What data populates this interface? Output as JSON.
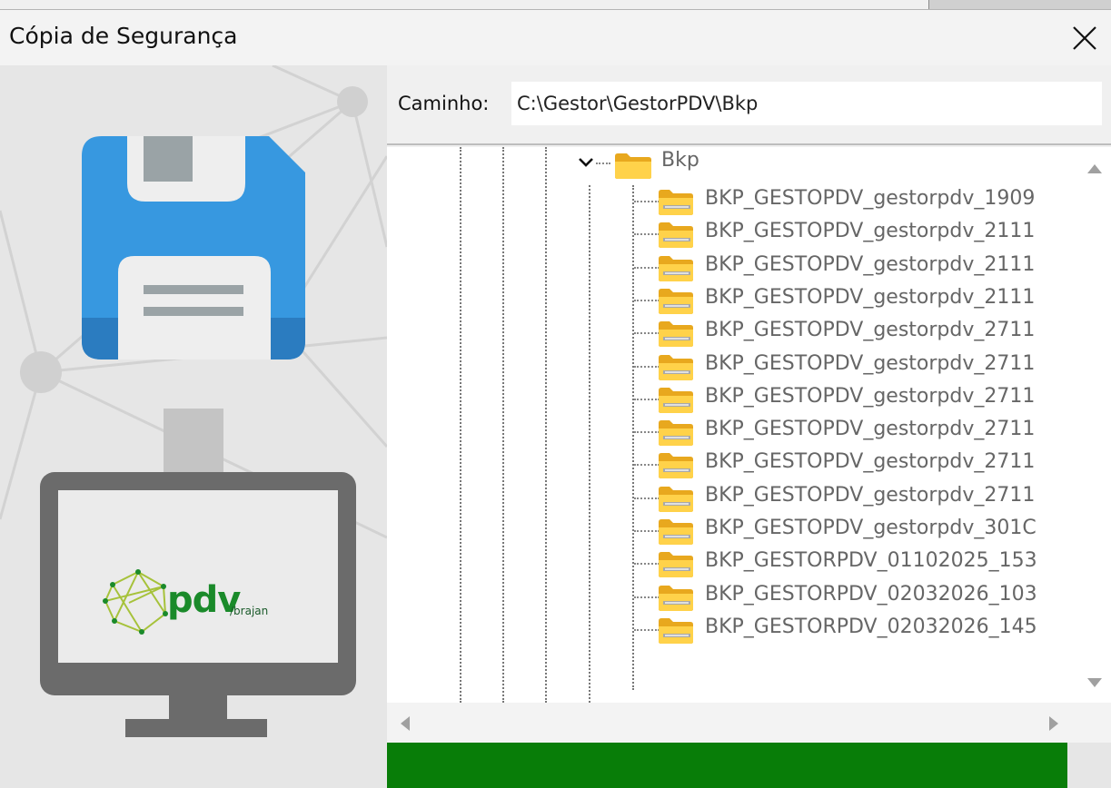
{
  "window": {
    "title": "Cópia de Segurança"
  },
  "branding": {
    "logo_text": "pdv",
    "logo_sub": "/brajan"
  },
  "path": {
    "label": "Caminho:",
    "value": "C:\\Gestor\\GestorPDV\\Bkp"
  },
  "tree": {
    "root": "Bkp",
    "items": [
      "BKP_GESTOPDV_gestorpdv_1909",
      "BKP_GESTOPDV_gestorpdv_2111",
      "BKP_GESTOPDV_gestorpdv_2111",
      "BKP_GESTOPDV_gestorpdv_2111",
      "BKP_GESTOPDV_gestorpdv_2711",
      "BKP_GESTOPDV_gestorpdv_2711",
      "BKP_GESTOPDV_gestorpdv_2711",
      "BKP_GESTOPDV_gestorpdv_2711",
      "BKP_GESTOPDV_gestorpdv_2711",
      "BKP_GESTOPDV_gestorpdv_2711",
      "BKP_GESTOPDV_gestorpdv_301C",
      "BKP_GESTORPDV_01102025_153",
      "BKP_GESTORPDV_02032026_103",
      "BKP_GESTORPDV_02032026_145"
    ]
  },
  "progress": {
    "fraction": 0.94
  },
  "colors": {
    "progress": "#087d08",
    "floppy": "#3798e0",
    "monitor": "#6b6b6b",
    "logo_green": "#1a8a2a",
    "logo_lime": "#a6c23a"
  },
  "icons": [
    "close-icon",
    "floppy-disk-icon",
    "down-arrow-icon",
    "monitor-icon",
    "folder-icon",
    "zip-folder-icon",
    "chevron-down-icon",
    "scroll-up-icon",
    "scroll-down-icon",
    "scroll-left-icon",
    "scroll-right-icon"
  ]
}
